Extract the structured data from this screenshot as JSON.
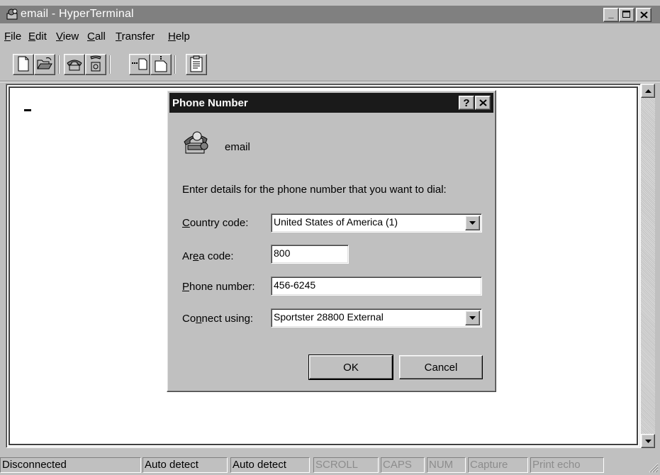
{
  "window": {
    "title": "email - HyperTerminal",
    "minimize_label": "_",
    "maximize_label": "□",
    "close_label": "✕"
  },
  "menu": [
    "File",
    "Edit",
    "View",
    "Call",
    "Transfer",
    "Help"
  ],
  "toolbar": {
    "buttons": [
      "new-icon",
      "open-icon",
      "connect-icon",
      "disconnect-icon",
      "send-icon",
      "receive-icon",
      "properties-icon"
    ]
  },
  "terminal": {
    "cursor": "_"
  },
  "dialog": {
    "title": "Phone Number",
    "help_label": "?",
    "close_label": "✕",
    "connection_name": "email",
    "instructions": "Enter details for the phone number that you want to dial:",
    "country_code": {
      "label_pre": "",
      "label_u": "C",
      "label_post": "ountry code:",
      "value": "United States of America (1)"
    },
    "area_code": {
      "label_pre": "Ar",
      "label_u": "e",
      "label_post": "a code:",
      "value": "800"
    },
    "phone_number": {
      "label_pre": "",
      "label_u": "P",
      "label_post": "hone number:",
      "value": "456-6245"
    },
    "connect_using": {
      "label_pre": "Co",
      "label_u": "n",
      "label_post": "nect using:",
      "value": "Sportster 28800 External"
    },
    "ok_label": "OK",
    "cancel_label": "Cancel"
  },
  "status": {
    "connection": "Disconnected",
    "detect1": "Auto detect",
    "detect2": "Auto detect",
    "scroll": "SCROLL",
    "caps": "CAPS",
    "num": "NUM",
    "capture": "Capture",
    "print_echo": "Print echo"
  }
}
